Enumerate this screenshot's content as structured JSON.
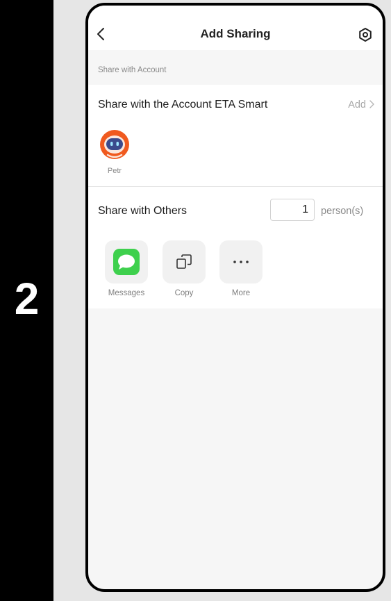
{
  "step": {
    "number": "2"
  },
  "header": {
    "title": "Add Sharing"
  },
  "account_section": {
    "caption": "Share with Account",
    "share_label": "Share with the Account ETA Smart",
    "add_label": "Add",
    "members": [
      {
        "name": "Petr"
      }
    ]
  },
  "others_section": {
    "label": "Share with Others",
    "count_value": "1",
    "count_unit": "person(s)",
    "options": [
      {
        "label": "Messages",
        "icon": "messages-icon"
      },
      {
        "label": "Copy",
        "icon": "copy-icon"
      },
      {
        "label": "More",
        "icon": "more-icon"
      }
    ]
  },
  "colors": {
    "messages_green": "#3ed04d",
    "avatar_orange": "#f05a1f",
    "background": "#f6f6f6"
  }
}
